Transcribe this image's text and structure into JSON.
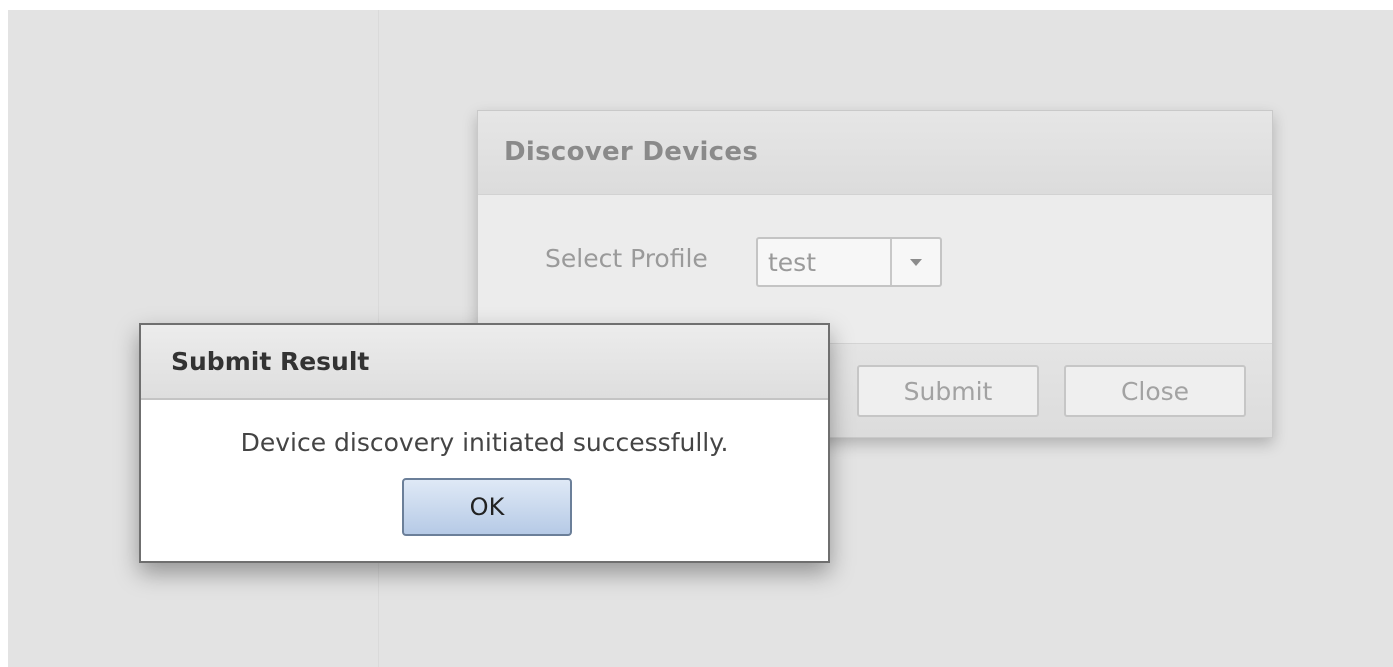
{
  "discover_dialog": {
    "title": "Discover Devices",
    "profile_label": "Select Profile",
    "profile_value": "test",
    "submit_label": "Submit",
    "close_label": "Close"
  },
  "result_dialog": {
    "title": "Submit Result",
    "message": "Device discovery initiated successfully.",
    "ok_label": "OK"
  },
  "icons": {
    "dropdown": "chevron-down-icon"
  },
  "colors": {
    "ok_button": "#b6cae6",
    "backdrop": "#e3e3e3"
  }
}
